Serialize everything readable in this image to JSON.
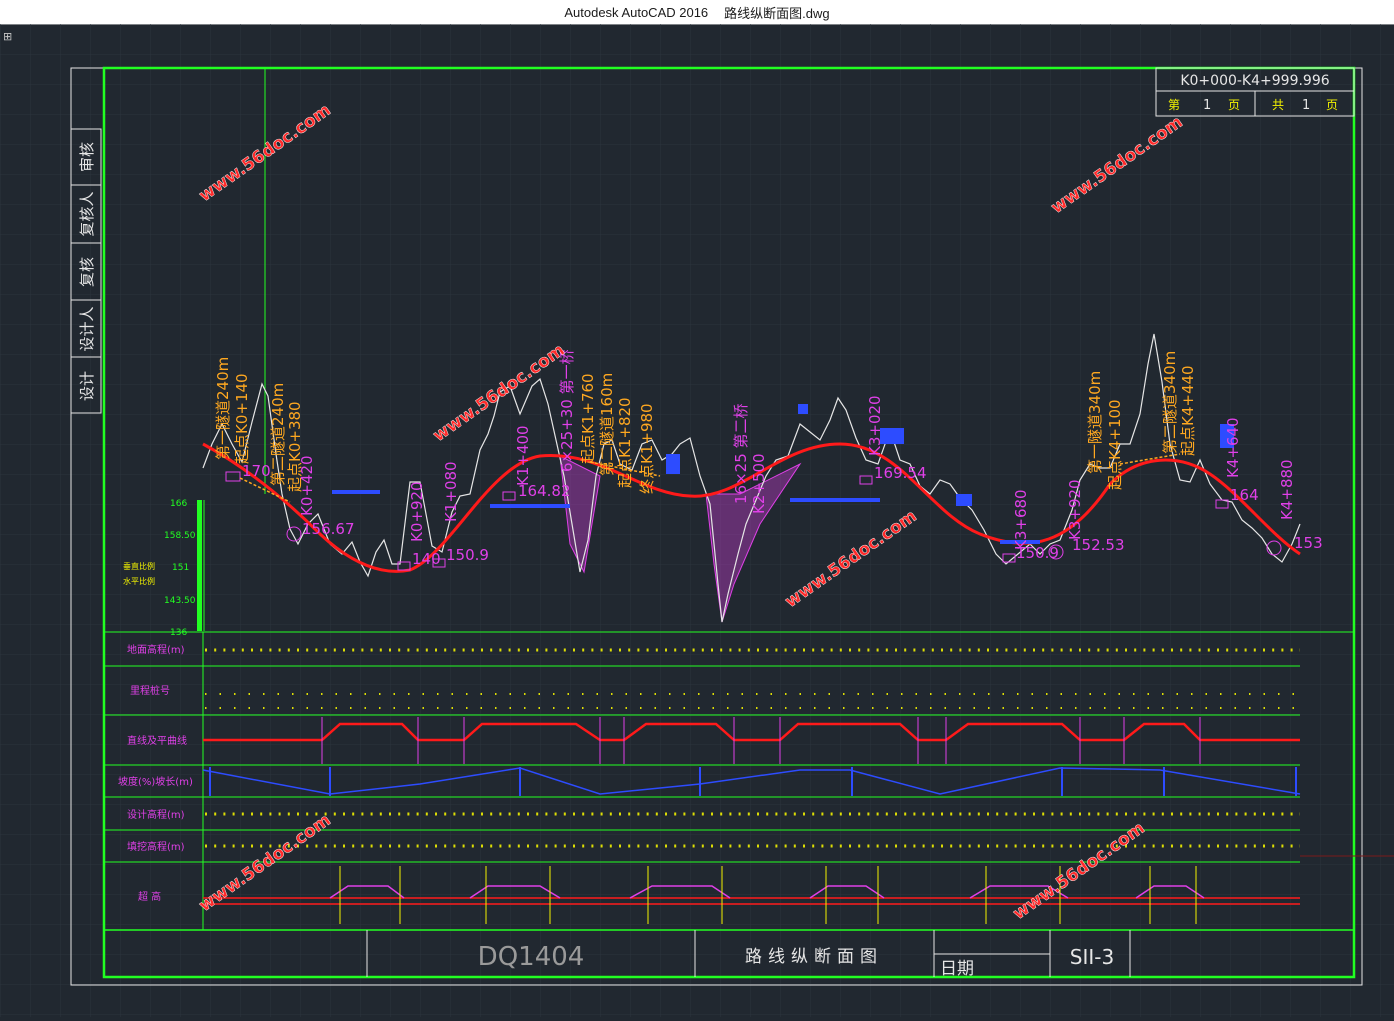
{
  "window": {
    "app": "Autodesk AutoCAD 2016",
    "file": "路线纵断面图.dwg",
    "corner_icon": "cad-app-icon"
  },
  "sign_block": [
    "设计",
    "设计人",
    "复核",
    "复核人",
    "审核"
  ],
  "page_block": {
    "range": "K0+000-K4+999.996",
    "page_prefix": "第",
    "page_no": "1",
    "page_unit": "页",
    "total_prefix": "共",
    "total_no": "1",
    "total_unit": "页"
  },
  "watermark": "www.56doc.com",
  "scale_labels": {
    "vertical": "垂直比例",
    "horizontal": "水平比例",
    "ticks": [
      "166",
      "158.50",
      "151",
      "143.50",
      "136"
    ]
  },
  "bridges": [
    "第一隧道240m",
    "起点K0+140",
    "第二隧道240m",
    "起点K0+380",
    "K0+420",
    "K0+920",
    "K1+080",
    "K1+400",
    "6×25+30 第一桥",
    "起点K1+760",
    "第二隧道160m",
    "起点K1+820",
    "终点K1+980",
    "16×25 第二桥",
    "K2+500",
    "K3+020",
    "K3+680",
    "K3+920",
    "第一隧道340m",
    "起点K4+100",
    "第二隧道340m",
    "起点K4+440",
    "K4+640",
    "K4+880"
  ],
  "elevations": [
    "170",
    "156.67",
    "140",
    "150.9",
    "164.82",
    "169.54",
    "150.9",
    "152.53",
    "164",
    "153"
  ],
  "row_labels": [
    "地面高程(m)",
    "里程桩号",
    "直线及平曲线",
    "坡度(%)坡长(m)",
    "设计高程(m)",
    "填挖高程(m)",
    "超 高"
  ],
  "drawing_no": "DQ1404",
  "drawing_title": "路线纵断面图",
  "date_label": "日期",
  "sheet_no": "SII-3",
  "colors": {
    "background": "#212830",
    "frame": "#22ff22",
    "design_line": "#ff1a1a",
    "ground_line": "#e6e6e6",
    "magenta": "#e040e8",
    "orange": "#ffa820",
    "blue": "#2d4cff",
    "yellow": "#f2f200",
    "watermark": "#ff2a2a"
  }
}
